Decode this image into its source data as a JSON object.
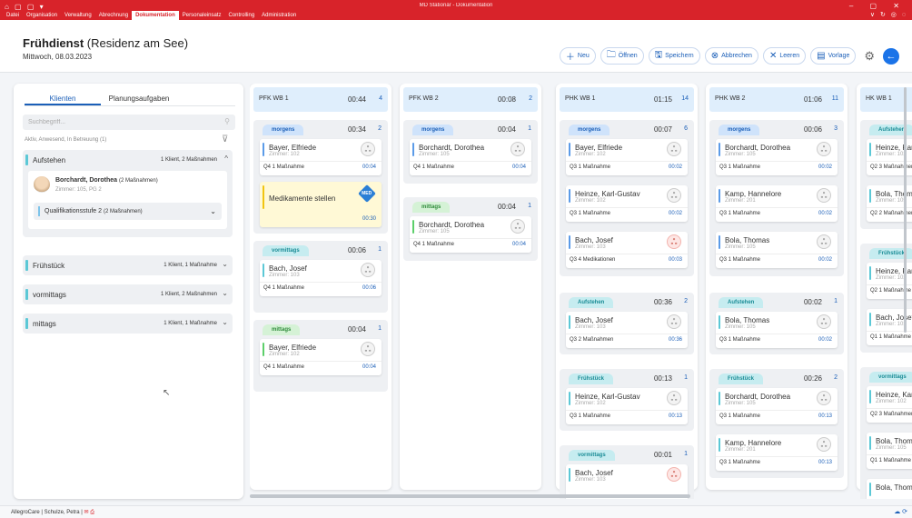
{
  "window": {
    "title": "MD Stationär - Dokumentation",
    "quickaccess": "⌂ ▢ ▢ ▾",
    "controls": "–  ▢  ✕",
    "ribbon_right": "∨ ↻ ◎ ◌"
  },
  "menu": [
    "Datei",
    "Organisation",
    "Verwaltung",
    "Abrechnung",
    "Dokumentation",
    "Personaleinsatz",
    "Controlling",
    "Administration"
  ],
  "menu_active": 4,
  "header": {
    "title_bold": "Frühdienst",
    "title_rest": "(Residenz am See)",
    "date": "Mittwoch, 08.03.2023"
  },
  "toolbar": {
    "neu": "Neu",
    "oeffnen": "Öffnen",
    "speichern": "Speichern",
    "abbrechen": "Abbrechen",
    "leeren": "Leeren",
    "vorlage": "Vorlage"
  },
  "left": {
    "tabs": [
      "Klienten",
      "Planungsaufgaben"
    ],
    "search_placeholder": "Suchbegriff...",
    "filter_text": "Aktiv, Anwesend, In Betreuung (1)",
    "groups": [
      {
        "name": "Aufstehen",
        "info": "1 Klient, 2 Maßnahmen",
        "color": "#5cc8d6",
        "chev": "^"
      },
      {
        "name": "Frühstück",
        "info": "1 Klient, 1 Maßnahme",
        "color": "#5cc8d6",
        "chev": "⌄"
      },
      {
        "name": "vormittags",
        "info": "1 Klient, 2 Maßnahmen",
        "color": "#5cc8d6",
        "chev": "⌄"
      },
      {
        "name": "mittags",
        "info": "1 Klient, 1 Maßnahme",
        "color": "#5cc8d6",
        "chev": "⌄"
      }
    ],
    "client": {
      "name": "Borchardt, Dorothea",
      "suffix": "(2 Maßnahmen)",
      "room": "Zimmer: 105, PG 2"
    },
    "qual": {
      "label": "Qualifikationsstufe 2",
      "suffix": "(2 Maßnahmen)"
    }
  },
  "statusbar": {
    "text": "AllegroCare | Schulze, Petra |",
    "icons": "✉ ⎙",
    "right": "☁ ⟳"
  }
}
